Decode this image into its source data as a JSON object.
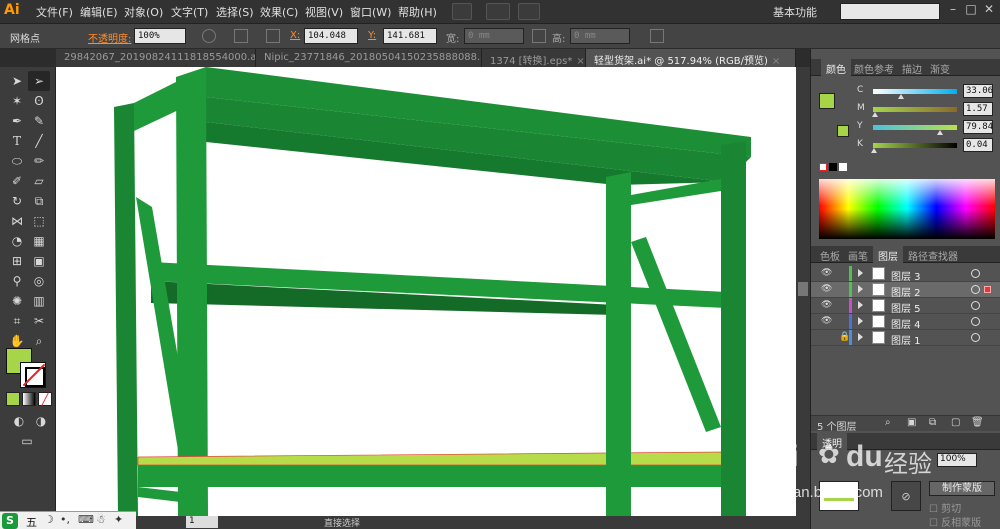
{
  "menubar": {
    "app_logo": "Ai",
    "items": [
      "文件(F)",
      "编辑(E)",
      "对象(O)",
      "文字(T)",
      "选择(S)",
      "效果(C)",
      "视图(V)",
      "窗口(W)",
      "帮助(H)"
    ],
    "workspace": "基本功能",
    "window_controls": [
      "–",
      "□",
      "✕"
    ]
  },
  "controlbar": {
    "selection_label": "网格点",
    "opacity_label": "不透明度:",
    "opacity_value": "100%",
    "x_label": "X:",
    "x_value": "104.048",
    "y_label": "Y:",
    "y_value": "141.681",
    "w_label": "宽:",
    "w_value": "0 mm",
    "h_label": "高:",
    "h_value": "0 mm"
  },
  "tabs": [
    {
      "label": "29842067_20190824111818554000.ai*",
      "active": false
    },
    {
      "label": "Nipic_23771846_20180504150235888088.ai*",
      "active": false
    },
    {
      "label": "1374 [转换].eps*",
      "active": false
    },
    {
      "label": "轻型货架.ai* @ 517.94% (RGB/预览)",
      "active": true
    }
  ],
  "colors": {
    "shelf_green": "#1f9a3a",
    "shelf_dark": "#177a2e",
    "shelf_darker": "#136b27",
    "fill_color": "#a6d54a",
    "accent_orange": "#ff8c28"
  },
  "color_panel": {
    "tabs": [
      "颜色",
      "颜色参考",
      "描边",
      "渐变"
    ],
    "channels": [
      {
        "key": "C",
        "value": "33.06",
        "level": 0.33
      },
      {
        "key": "M",
        "value": "1.57",
        "level": 0.02
      },
      {
        "key": "Y",
        "value": "79.84",
        "level": 0.8
      },
      {
        "key": "K",
        "value": "0.04",
        "level": 0.0
      }
    ]
  },
  "layers_panel": {
    "tabs": [
      "色板",
      "画笔",
      "图层",
      "路径查找器"
    ],
    "layers": [
      {
        "name": "图层 3",
        "color": "#4fc24f",
        "visible": true,
        "selected": false
      },
      {
        "name": "图层 2",
        "color": "#4fc24f",
        "visible": true,
        "selected": true
      },
      {
        "name": "图层 5",
        "color": "#c84fc8",
        "visible": true,
        "selected": false
      },
      {
        "name": "图层 4",
        "color": "#4f6fd8",
        "visible": true,
        "selected": false
      },
      {
        "name": "图层 1",
        "color": "#4f8fd8",
        "visible": false,
        "selected": false,
        "locked": true
      }
    ],
    "count_label": "5 个图层"
  },
  "transparency_panel": {
    "title": "透明",
    "opacity_value": "100%",
    "make_mask_label": "制作蒙版",
    "clip_label": "剪切",
    "invert_label": "反相蒙版"
  },
  "statusbar": {
    "zoom": "24",
    "page": "1",
    "tool": "直接选择"
  },
  "watermark": {
    "brand": "Bai",
    "brand2": "du",
    "suffix": "经验",
    "url": "jingyan.baidu.com"
  },
  "taskbar": {
    "ime_label": "五"
  }
}
